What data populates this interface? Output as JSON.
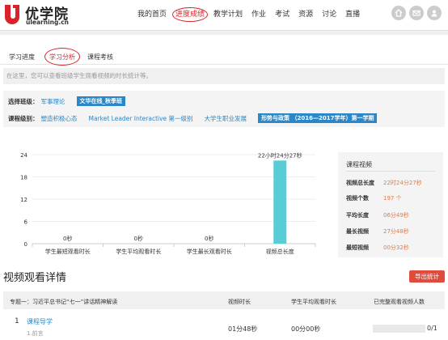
{
  "header": {
    "logo_cn": "优学院",
    "logo_en": "ulearning.cn",
    "nav": [
      "我的首页",
      "进度成绩",
      "教学计划",
      "作业",
      "考试",
      "资源",
      "讨论",
      "直播"
    ],
    "active_nav": "进度成绩",
    "icons": [
      "home-icon",
      "mail-icon",
      "user-icon"
    ]
  },
  "subtabs": [
    "学习进度",
    "学习分析",
    "课程考核"
  ],
  "info_text": "在这里，您可以查看班级学生观看视频的时长统计等。",
  "filters": {
    "class_label": "选择班级：",
    "classes": [
      "军事理论",
      "文华在线_秋季班"
    ],
    "course_label": "课程级别：",
    "courses": [
      "塑造积极心态",
      "Market Leader Interactive 第一级别",
      "大学生职业发展",
      "形势与政策 （2016—2017学年）第一学期"
    ]
  },
  "chart_data": {
    "type": "bar",
    "categories": [
      "学生最短观看时长",
      "学生平均观看时长",
      "学生最长观看时长",
      "视频总长度"
    ],
    "values": [
      0,
      0,
      0,
      22.4
    ],
    "data_labels": [
      "0秒",
      "0秒",
      "0秒",
      "22小时24分27秒"
    ],
    "y_ticks": [
      0,
      6,
      12,
      18,
      24
    ],
    "ylim": [
      0,
      24
    ],
    "bar_color": "#59cdd6",
    "grid": true
  },
  "stats": {
    "title": "课程视频",
    "rows": [
      {
        "label": "视频总长度",
        "value": "22时24分27秒"
      },
      {
        "label": "视频个数",
        "value": "197 个"
      },
      {
        "label": "平均长度",
        "value": "06分49秒"
      },
      {
        "label": "最长视频",
        "value": "27分48秒"
      },
      {
        "label": "最短视频",
        "value": "00分32秒"
      }
    ]
  },
  "detail": {
    "title": "视频观看详情",
    "export_label": "导出统计",
    "columns": [
      "专题一：习近平总书记“七一”讲话精神解读",
      "视频时长",
      "学生平均观看时长",
      "已完整观看视频人数"
    ],
    "rows": [
      {
        "num": "1",
        "title": "课程导学",
        "sub": "1.前言",
        "duration": "01分48秒",
        "avg": "00分00秒",
        "progress": 0,
        "complete": "0/1"
      }
    ]
  },
  "colors": {
    "accent": "#d9222a",
    "link": "#2a87c8",
    "stat_value": "#e8773c",
    "export": "#e24a3b"
  }
}
